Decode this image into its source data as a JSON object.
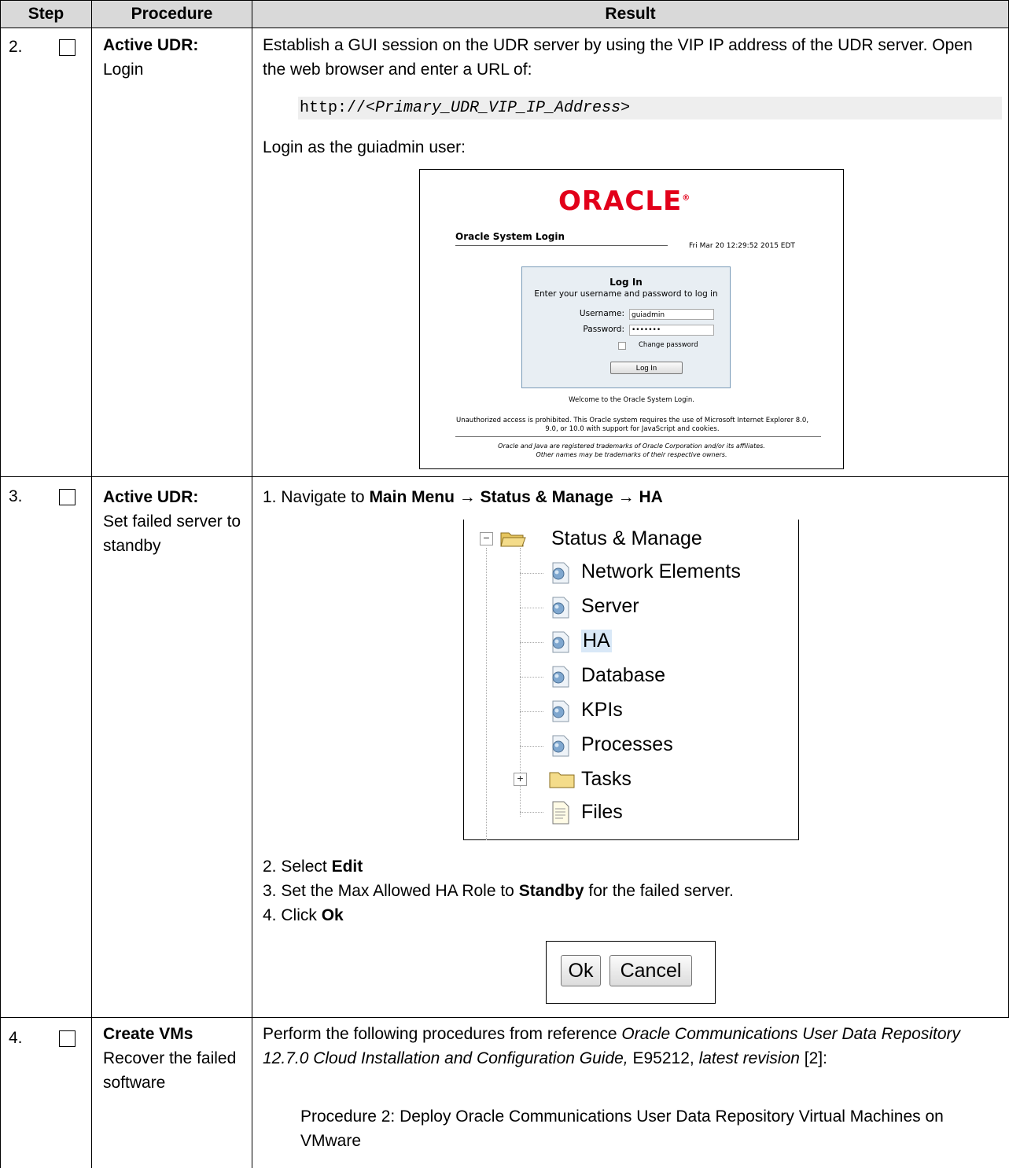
{
  "headers": {
    "step": "Step",
    "procedure": "Procedure",
    "result": "Result"
  },
  "step2": {
    "number": "2.",
    "proc_bold": "Active UDR:",
    "proc_text": "Login",
    "intro": "Establish a GUI session on the UDR server by using the VIP IP address of the UDR server. Open the web browser and enter a URL of:",
    "url_prefix": "http://<",
    "url_var": "Primary_UDR_VIP_IP_Address",
    "url_suffix": ">",
    "login_as": "Login as the guiadmin user:",
    "login": {
      "logo": "ORACLE",
      "registered": "®",
      "system_login": "Oracle System Login",
      "datetime": "Fri Mar 20 12:29:52 2015 EDT",
      "box_title": "Log In",
      "box_sub": "Enter your username and password to log in",
      "username_label": "Username:",
      "username_value": "guiadmin",
      "password_label": "Password:",
      "password_value": "•••••••",
      "change_password": "Change password",
      "login_button": "Log In",
      "welcome": "Welcome to the Oracle System Login.",
      "unauthorized": "Unauthorized access is prohibited. This Oracle system requires the use of Microsoft Internet Explorer 8.0, 9.0, or 10.0 with support for JavaScript and cookies.",
      "trademark1": "Oracle and Java are registered trademarks of Oracle Corporation and/or its affiliates.",
      "trademark2": "Other names may be trademarks of their respective owners."
    }
  },
  "step3": {
    "number": "3.",
    "proc_bold": "Active UDR:",
    "proc_text": "Set failed server to standby",
    "item1_num": "1.",
    "item1_text": "Navigate to ",
    "item1_path": "Main Menu → Status & Manage → HA",
    "tree": {
      "root": "Status & Manage",
      "items": [
        "Network Elements",
        "Server",
        "HA",
        "Database",
        "KPIs",
        "Processes"
      ],
      "tasks": "Tasks",
      "files": "Files",
      "expand_symbol": "+",
      "collapse_symbol": "−"
    },
    "item2_num": "2.",
    "item2_text": "Select ",
    "item2_bold": "Edit",
    "item3_num": "3.",
    "item3_text_a": "Set the Max Allowed HA Role to ",
    "item3_bold": "Standby",
    "item3_text_b": " for the failed server.",
    "item4_num": "4.",
    "item4_text": "Click ",
    "item4_bold": "Ok",
    "ok_button": "Ok",
    "cancel_button": "Cancel"
  },
  "step4": {
    "number": "4.",
    "proc_bold": "Create VMs",
    "proc_text": "Recover the failed software",
    "intro_a": "Perform the following procedures from reference ",
    "intro_italic": "Oracle Communications User Data Repository 12.7.0 Cloud Installation and Configuration Guide,",
    "intro_b": " E95212, ",
    "intro_italic2": "latest revision",
    "intro_c": " [2]:",
    "procedure": "Procedure 2: Deploy Oracle Communications User Data Repository Virtual Machines on VMware"
  },
  "colors": {
    "header_bg": "#d9d9d9",
    "oracle_red": "#e2001a",
    "login_box_bg": "#e8eef3",
    "code_bg": "#eeeeee"
  }
}
